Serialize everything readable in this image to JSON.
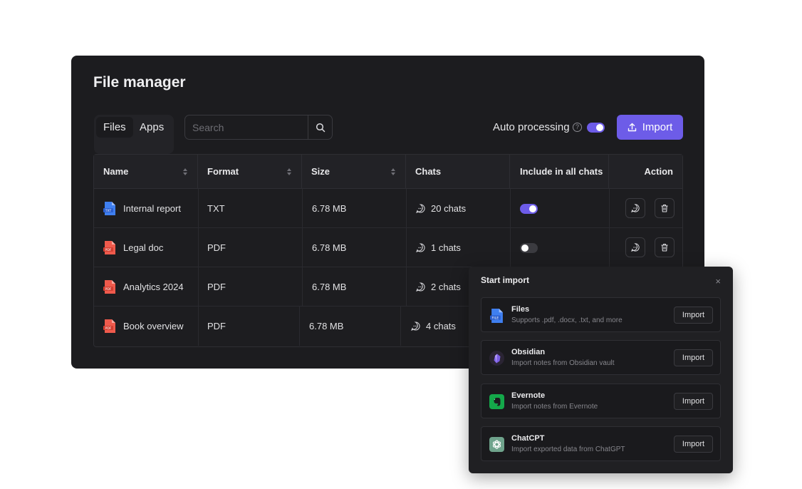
{
  "header": {
    "title": "File manager"
  },
  "tabs": [
    {
      "label": "Files"
    },
    {
      "label": "Apps"
    }
  ],
  "search": {
    "placeholder": "Search",
    "value": ""
  },
  "auto_processing": {
    "label": "Auto processing",
    "help": "?",
    "enabled": true
  },
  "import_button": {
    "label": "Import"
  },
  "table": {
    "columns": [
      "Name",
      "Format",
      "Size",
      "Chats",
      "Include in all chats",
      "Action"
    ],
    "rows": [
      {
        "name": "Internal report",
        "icon": "txt-file-icon",
        "format": "TXT",
        "size": "6.78 MB",
        "chats": "20 chats",
        "include": true
      },
      {
        "name": "Legal doc",
        "icon": "pdf-file-icon",
        "format": "PDF",
        "size": "6.78 MB",
        "chats": "1 chats",
        "include": false
      },
      {
        "name": "Analytics 2024",
        "icon": "pdf-file-icon",
        "format": "PDF",
        "size": "6.78 MB",
        "chats": "2 chats",
        "include": null
      },
      {
        "name": "Book overview",
        "icon": "pdf-file-icon",
        "format": "PDF",
        "size": "6.78 MB",
        "chats": "4 chats",
        "include": null
      }
    ]
  },
  "colors": {
    "accent": "#6d5ce8",
    "panel": "#1c1c1f",
    "pdf_icon": "#ef5a4c",
    "txt_icon": "#3f7ff0"
  },
  "import_dialog": {
    "title": "Start import",
    "close": "×",
    "items": [
      {
        "name": "Files",
        "desc": "Supports .pdf, .docx, .txt, and more",
        "button": "Import",
        "icon": "file-icon"
      },
      {
        "name": "Obsidian",
        "desc": "Import notes from Obsidian vault",
        "button": "Import",
        "icon": "obsidian-icon"
      },
      {
        "name": "Evernote",
        "desc": "Import notes from Evernote",
        "button": "Import",
        "icon": "evernote-icon"
      },
      {
        "name": "ChatCPT",
        "desc": "Import exported data from ChatGPT",
        "button": "Import",
        "icon": "chatgpt-icon"
      }
    ]
  }
}
